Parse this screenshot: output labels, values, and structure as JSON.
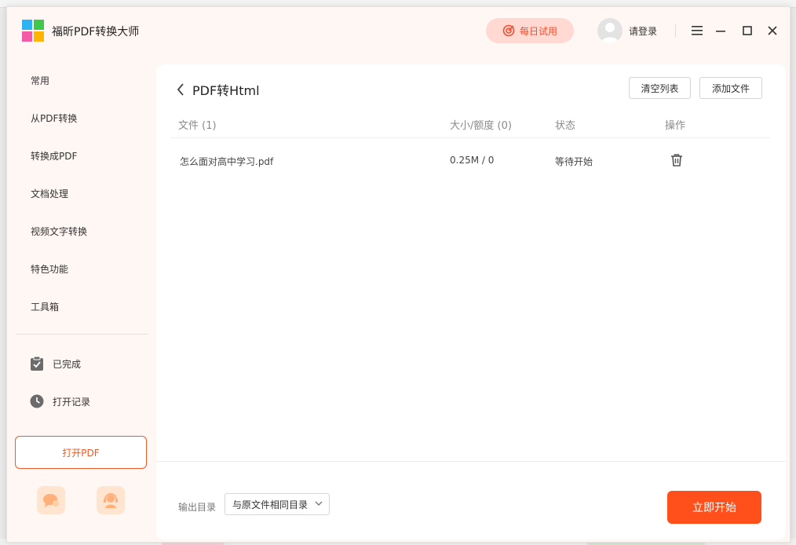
{
  "app": {
    "title": "福昕PDF转换大师"
  },
  "header": {
    "trial_label": "每日试用",
    "login_label": "请登录"
  },
  "sidebar": {
    "items": [
      {
        "label": "常用"
      },
      {
        "label": "从PDF转换"
      },
      {
        "label": "转换成PDF"
      },
      {
        "label": "文档处理"
      },
      {
        "label": "视频文字转换"
      },
      {
        "label": "特色功能"
      },
      {
        "label": "工具箱"
      }
    ],
    "completed_label": "已完成",
    "history_label": "打开记录",
    "open_pdf_label": "打开PDF"
  },
  "main": {
    "title": "PDF转Html",
    "clear_label": "清空列表",
    "add_label": "添加文件",
    "columns": {
      "file": "文件 (1)",
      "size": "大小/额度 (0)",
      "status": "状态",
      "action": "操作"
    },
    "rows": [
      {
        "file": "怎么面对高中学习.pdf",
        "size": "0.25M / 0",
        "status": "等待开始"
      }
    ]
  },
  "footer": {
    "output_label": "输出目录",
    "output_value": "与原文件相同目录",
    "start_label": "立即开始"
  },
  "colors": {
    "accent": "#ff4f1a",
    "trial_bg": "#ffd9d2",
    "sidebar_bg": "#fff7f4"
  }
}
